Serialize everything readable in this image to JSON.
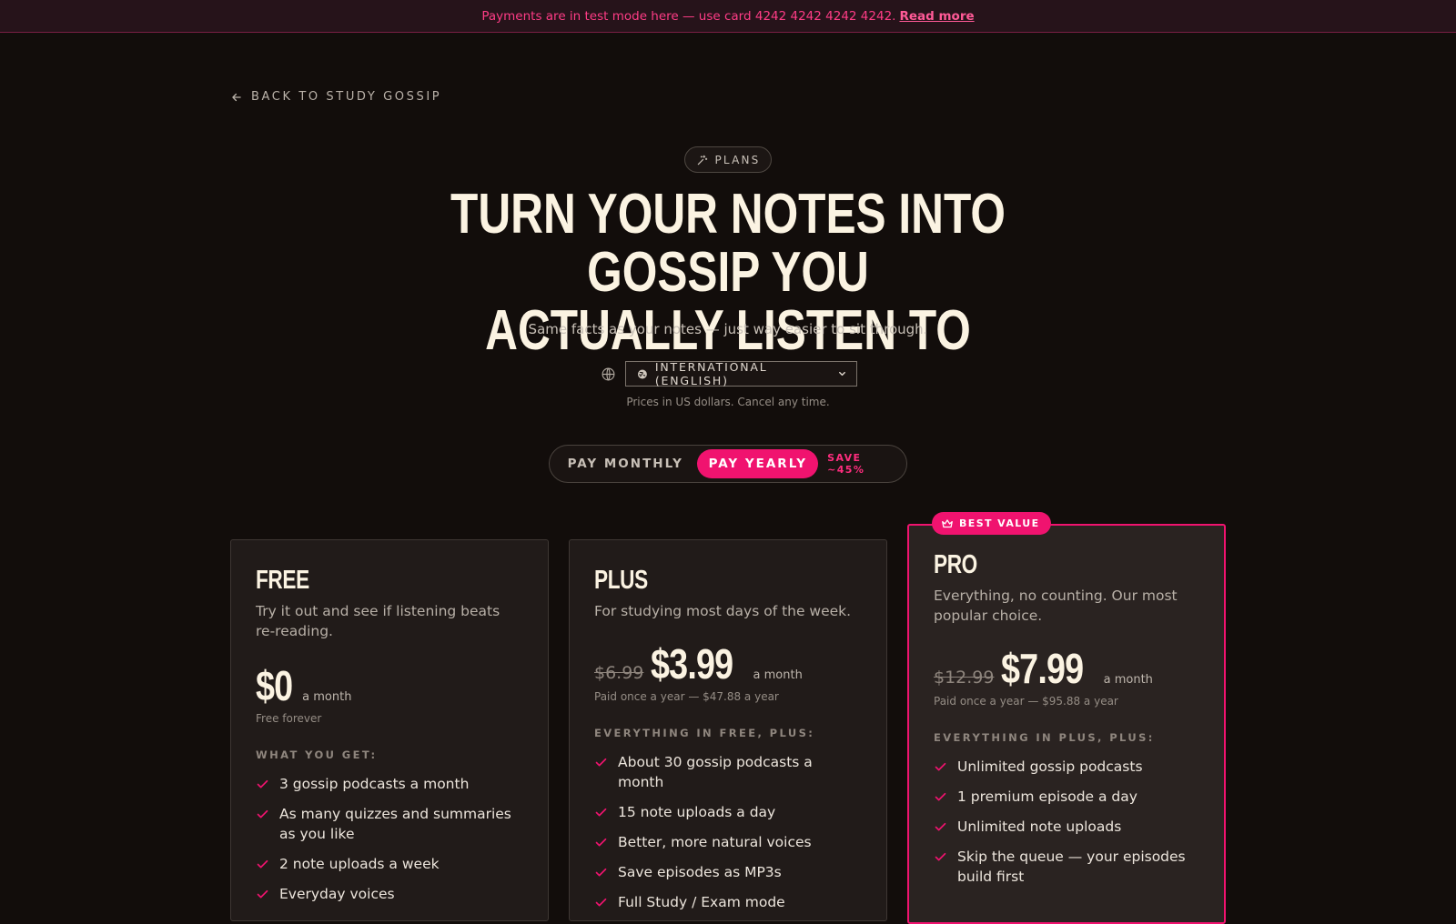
{
  "banner": {
    "text": "Payments are in test mode here — use card 4242 4242 4242 4242.",
    "link": "Read more"
  },
  "nav": {
    "back_label": "BACK TO STUDY GOSSIP",
    "back_icon": "arrow-left-icon"
  },
  "hero": {
    "pill_label": "PLANS",
    "pill_icon": "sparkles-icon",
    "title_line1": "TURN YOUR NOTES INTO GOSSIP YOU",
    "title_line2": "ACTUALLY LISTEN TO",
    "subtitle": "Same facts as your notes — just way easier to sit through."
  },
  "region": {
    "selected": "INTERNATIONAL (ENGLISH)",
    "note": "Prices in US dollars. Cancel any time."
  },
  "billing_toggle": {
    "monthly": "PAY MONTHLY",
    "yearly": "PAY YEARLY",
    "save": "SAVE ~45%",
    "active": "yearly"
  },
  "plans": [
    {
      "name": "FREE",
      "description": "Try it out and see if listening beats re-reading.",
      "old_price": "",
      "price": "$0",
      "per": "a month",
      "billing": "Free forever",
      "features_heading": "WHAT YOU GET:",
      "features": [
        "3 gossip podcasts a month",
        "As many quizzes and summaries as you like",
        "2 note uploads a week",
        "Everyday voices"
      ]
    },
    {
      "name": "PLUS",
      "description": "For studying most days of the week.",
      "old_price": "$6.99",
      "price": "$3.99",
      "per": "a month",
      "billing": "Paid once a year — $47.88 a year",
      "features_heading": "EVERYTHING IN FREE, PLUS:",
      "features": [
        "About 30 gossip podcasts a month",
        "15 note uploads a day",
        "Better, more natural voices",
        "Save episodes as MP3s",
        "Full Study / Exam mode"
      ]
    },
    {
      "name": "PRO",
      "badge": "BEST VALUE",
      "description": "Everything, no counting. Our most popular choice.",
      "old_price": "$12.99",
      "price": "$7.99",
      "per": "a month",
      "billing": "Paid once a year — $95.88 a year",
      "features_heading": "EVERYTHING IN PLUS, PLUS:",
      "features": [
        "Unlimited gossip podcasts",
        "1 premium episode a day",
        "Unlimited note uploads",
        "Skip the queue — your episodes build first"
      ]
    }
  ],
  "colors": {
    "accent": "#f0136f",
    "background": "#120d0b",
    "card": "#211b19",
    "headline": "#fbf3e2"
  }
}
